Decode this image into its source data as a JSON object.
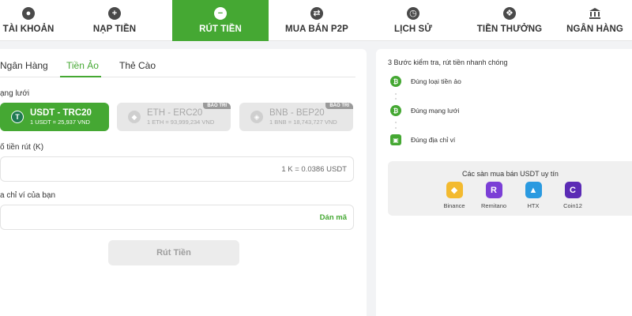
{
  "nav": {
    "items": [
      {
        "label": "TÀI KHOẢN",
        "icon": "user-circle-icon"
      },
      {
        "label": "NẠP TIỀN",
        "icon": "plus-circle-icon"
      },
      {
        "label": "RÚT TIỀN",
        "icon": "minus-circle-icon",
        "active": true
      },
      {
        "label": "MUA BÁN P2P",
        "icon": "exchange-arrows-icon"
      },
      {
        "label": "LỊCH SỬ",
        "icon": "clock-icon"
      },
      {
        "label": "TIỀN THƯỞNG",
        "icon": "gift-icon"
      },
      {
        "label": "NGÂN HÀNG",
        "icon": "bank-icon"
      }
    ]
  },
  "withdraw": {
    "tabs": [
      "Ngân Hàng",
      "Tiền Ảo",
      "Thẻ Cào"
    ],
    "active_tab": "Tiền Ảo",
    "network_label": "ạng lưới",
    "networks": [
      {
        "name": "USDT - TRC20",
        "rate": "1 USDT = 25,937 VND",
        "status": "active"
      },
      {
        "name": "ETH - ERC20",
        "rate": "1 ETH = 93,999,234 VND",
        "badge": "BẢO TRÌ",
        "status": "disabled"
      },
      {
        "name": "BNB - BEP20",
        "rate": "1 BNB = 18,743,727 VND",
        "badge": "BẢO TRÌ",
        "status": "disabled"
      }
    ],
    "amount_label": "ố tiền rút (K)",
    "amount_value": "",
    "conversion_hint": "1 K = 0.0386 USDT",
    "address_label": "a chỉ ví của bạn",
    "address_value": "",
    "paste_label": "Dán mã",
    "submit_label": "Rút Tiền"
  },
  "guide": {
    "title": "3 Bước kiểm tra, rút tiền nhanh chóng",
    "steps": [
      "Đúng loại tiền ảo",
      "Đúng mạng lưới",
      "Đúng địa chỉ ví"
    ]
  },
  "exchanges": {
    "title": "Các sàn mua bán USDT uy tín",
    "items": [
      {
        "name": "Binance",
        "color": "#f3ba2f"
      },
      {
        "name": "Remitano",
        "color": "#7b3fd6"
      },
      {
        "name": "HTX",
        "color": "#2a9ae0"
      },
      {
        "name": "Coin12",
        "color": "#5b2bb5"
      }
    ]
  },
  "colors": {
    "accent": "#45a833",
    "disabled": "#e7e7e7"
  }
}
